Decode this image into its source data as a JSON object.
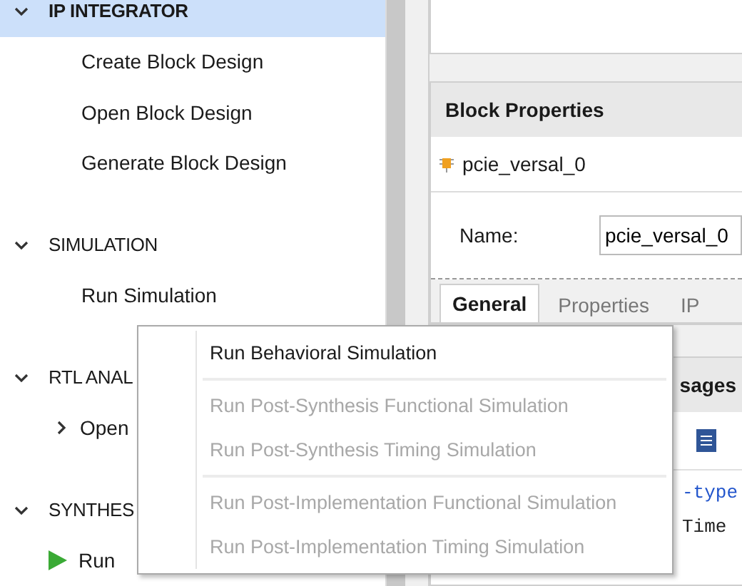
{
  "sidebar": {
    "sections": [
      {
        "title": "IP INTEGRATOR",
        "expanded": true,
        "selected": true,
        "items": [
          {
            "label": "Create Block Design",
            "kind": "plain"
          },
          {
            "label": "Open Block Design",
            "kind": "plain"
          },
          {
            "label": "Generate Block Design",
            "kind": "plain"
          }
        ]
      },
      {
        "title": "SIMULATION",
        "expanded": true,
        "selected": false,
        "items": [
          {
            "label": "Run Simulation",
            "kind": "plain"
          }
        ]
      },
      {
        "title": "RTL ANAL",
        "expanded": true,
        "selected": false,
        "items": [
          {
            "label": "Open",
            "kind": "collapsed"
          }
        ]
      },
      {
        "title": "SYNTHES",
        "expanded": true,
        "selected": false,
        "items": [
          {
            "label": "Run",
            "kind": "run"
          }
        ]
      }
    ]
  },
  "block_properties": {
    "title": "Block Properties",
    "object_name": "pcie_versal_0",
    "name_label": "Name:",
    "name_value": "pcie_versal_0",
    "tabs": [
      {
        "label": "General",
        "selected": true
      },
      {
        "label": "Properties",
        "selected": false
      },
      {
        "label": "IP",
        "selected": false
      }
    ]
  },
  "messages": {
    "title": "sages"
  },
  "console": {
    "lines": [
      {
        "text": "-type",
        "kind": "keyword"
      },
      {
        "text": "Time",
        "kind": "plain"
      }
    ]
  },
  "context_menu": {
    "groups": [
      [
        {
          "label": "Run Behavioral Simulation",
          "disabled": false
        }
      ],
      [
        {
          "label": "Run Post-Synthesis Functional Simulation",
          "disabled": true
        },
        {
          "label": "Run Post-Synthesis Timing Simulation",
          "disabled": true
        }
      ],
      [
        {
          "label": "Run Post-Implementation Functional Simulation",
          "disabled": true
        },
        {
          "label": "Run Post-Implementation Timing Simulation",
          "disabled": true
        }
      ]
    ]
  }
}
